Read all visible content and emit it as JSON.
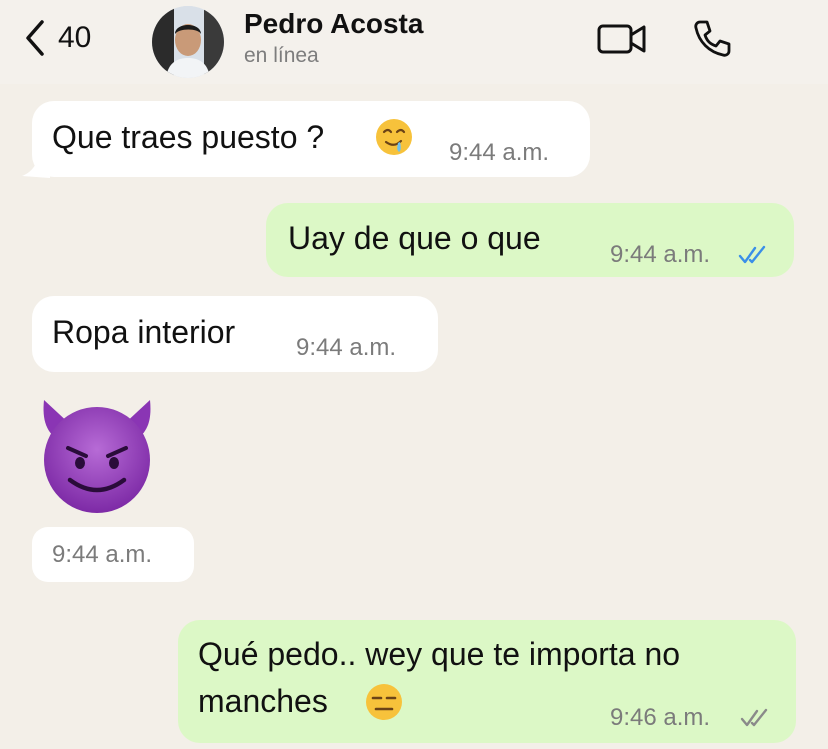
{
  "header": {
    "back_count": "40",
    "contact_name": "Pedro Acosta",
    "contact_status": "en línea",
    "icons": [
      "chevron-left-icon",
      "avatar",
      "video-camera-icon",
      "phone-icon"
    ]
  },
  "messages": [
    {
      "direction": "incoming",
      "text": "Que traes puesto ?",
      "emoji": "drooling-face",
      "time": "9:44 a.m."
    },
    {
      "direction": "outgoing",
      "text": "Uay de que o que",
      "time": "9:44 a.m.",
      "status": "read"
    },
    {
      "direction": "incoming",
      "text": "Ropa interior",
      "time": "9:44 a.m."
    },
    {
      "direction": "incoming",
      "emoji": "smiling-face-with-horns",
      "time": "9:44 a.m."
    },
    {
      "direction": "outgoing",
      "text_line1": "Qué pedo.. wey que te importa no",
      "text_line2": "manches",
      "emoji": "expressionless-face",
      "time": "9:46 a.m.",
      "status": "delivered"
    }
  ],
  "colors": {
    "background": "#f3efe8",
    "incoming_bubble": "#ffffff",
    "outgoing_bubble": "#dcf8c6",
    "read_tick": "#3a8fe8",
    "delivered_tick": "#8a8a8a"
  }
}
